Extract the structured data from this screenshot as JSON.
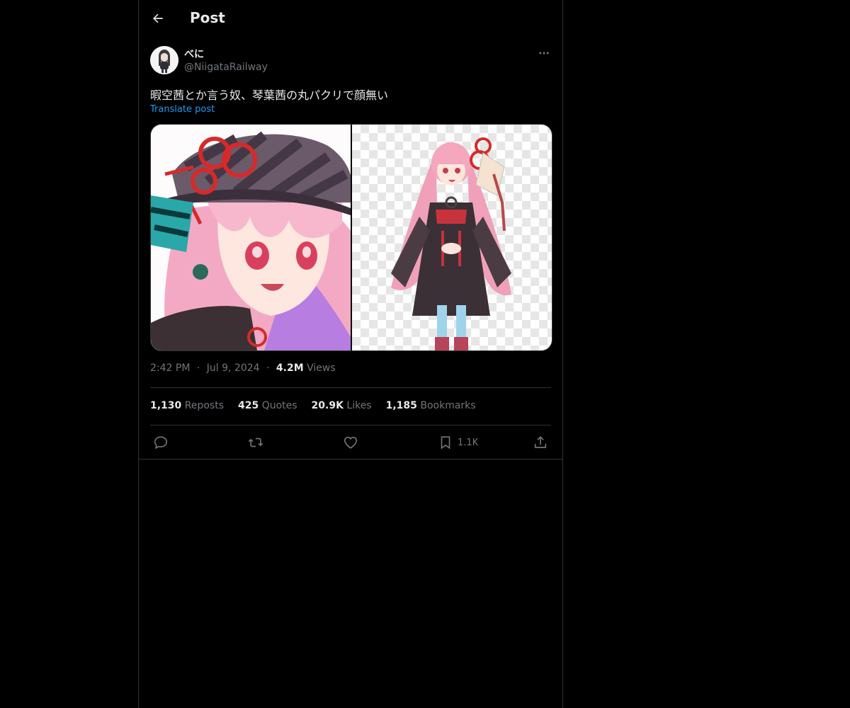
{
  "header": {
    "title": "Post",
    "back_icon": "arrow-left-icon"
  },
  "author": {
    "display_name": "べに",
    "handle": "@NiigataRailway",
    "more_icon": "more-horizontal-icon"
  },
  "post": {
    "text": "暇空茜とか言う奴、琴葉茜の丸パクリで顔無い",
    "translate_label": "Translate post",
    "time": "2:42 PM",
    "date": "Jul 9, 2024",
    "views_count": "4.2M",
    "views_label": "Views",
    "separator": "·"
  },
  "stats": {
    "reposts_count": "1,130",
    "reposts_label": "Reposts",
    "quotes_count": "425",
    "quotes_label": "Quotes",
    "likes_count": "20.9K",
    "likes_label": "Likes",
    "bookmarks_count": "1,185",
    "bookmarks_label": "Bookmarks"
  },
  "actions": {
    "reply_icon": "reply-icon",
    "repost_icon": "repost-icon",
    "like_icon": "heart-icon",
    "bookmark_icon": "bookmark-icon",
    "bookmark_count": "1.1K",
    "share_icon": "share-icon"
  },
  "colors": {
    "background": "#000000",
    "text_primary": "#e7e9ea",
    "text_secondary": "#71767b",
    "link": "#1d9bf0",
    "border": "#2f3336"
  }
}
